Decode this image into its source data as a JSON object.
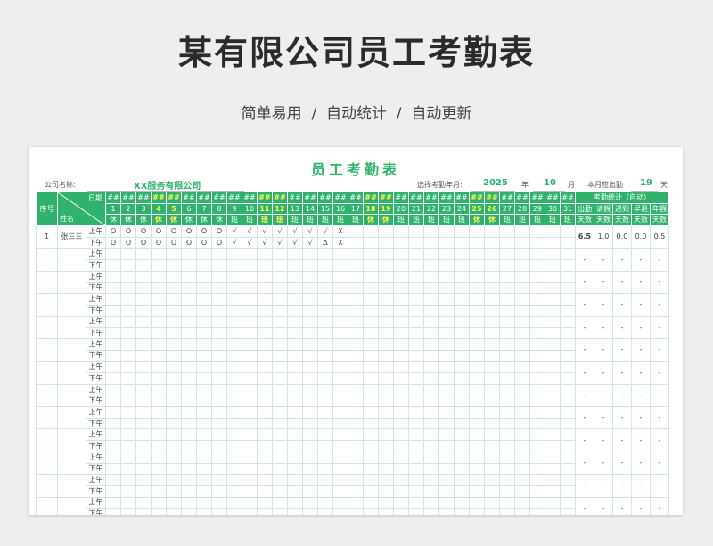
{
  "header": {
    "title": "某有限公司员工考勤表",
    "subtitle": "简单易用  /  自动统计  /  自动更新"
  },
  "sheet": {
    "title": "员工考勤表",
    "company_label": "公司名称:",
    "company_value": "XX服务有限公司",
    "month_label": "选择考勤年月:",
    "year_value": "2025",
    "year_unit": "年",
    "month_value": "10",
    "month_unit": "月",
    "should_label": "本月应出勤",
    "should_value": "19",
    "should_unit": "天",
    "col_seq": "序号",
    "col_name": "姓名",
    "col_date": "日期",
    "weekday_placeholder": "##",
    "days": [
      {
        "n": "1",
        "s": "休",
        "hl": false
      },
      {
        "n": "2",
        "s": "休",
        "hl": false
      },
      {
        "n": "3",
        "s": "休",
        "hl": false
      },
      {
        "n": "4",
        "s": "休",
        "hl": true
      },
      {
        "n": "5",
        "s": "休",
        "hl": true
      },
      {
        "n": "6",
        "s": "休",
        "hl": false
      },
      {
        "n": "7",
        "s": "休",
        "hl": false
      },
      {
        "n": "8",
        "s": "休",
        "hl": false
      },
      {
        "n": "9",
        "s": "班",
        "hl": false
      },
      {
        "n": "10",
        "s": "班",
        "hl": false
      },
      {
        "n": "11",
        "s": "班",
        "hl": true
      },
      {
        "n": "12",
        "s": "班",
        "hl": true
      },
      {
        "n": "13",
        "s": "班",
        "hl": false
      },
      {
        "n": "14",
        "s": "班",
        "hl": false
      },
      {
        "n": "15",
        "s": "班",
        "hl": false
      },
      {
        "n": "16",
        "s": "班",
        "hl": false
      },
      {
        "n": "17",
        "s": "班",
        "hl": false
      },
      {
        "n": "18",
        "s": "休",
        "hl": true
      },
      {
        "n": "19",
        "s": "休",
        "hl": true
      },
      {
        "n": "20",
        "s": "班",
        "hl": false
      },
      {
        "n": "21",
        "s": "班",
        "hl": false
      },
      {
        "n": "22",
        "s": "班",
        "hl": false
      },
      {
        "n": "23",
        "s": "班",
        "hl": false
      },
      {
        "n": "24",
        "s": "班",
        "hl": false
      },
      {
        "n": "25",
        "s": "休",
        "hl": true
      },
      {
        "n": "26",
        "s": "休",
        "hl": true
      },
      {
        "n": "27",
        "s": "班",
        "hl": false
      },
      {
        "n": "28",
        "s": "班",
        "hl": false
      },
      {
        "n": "29",
        "s": "班",
        "hl": false
      },
      {
        "n": "30",
        "s": "班",
        "hl": false
      },
      {
        "n": "31",
        "s": "班",
        "hl": false
      }
    ],
    "stats_title": "考勤统计（自动）",
    "stats_cols": [
      {
        "top": "出勤",
        "bot": "天数"
      },
      {
        "top": "请假",
        "bot": "天数"
      },
      {
        "top": "迟到",
        "bot": "天数"
      },
      {
        "top": "早退",
        "bot": "天数"
      },
      {
        "top": "年假",
        "bot": "天数"
      }
    ],
    "am_label": "上午",
    "pm_label": "下午",
    "dash": "-",
    "employees": [
      {
        "seq": "1",
        "name": "张三三",
        "am": [
          "O",
          "O",
          "O",
          "O",
          "O",
          "O",
          "O",
          "O",
          "√",
          "√",
          "√",
          "√",
          "√",
          "√",
          "√",
          "X"
        ],
        "pm": [
          "O",
          "O",
          "O",
          "O",
          "O",
          "O",
          "O",
          "O",
          "√",
          "√",
          "√",
          "√",
          "√",
          "√",
          "Δ",
          "X"
        ],
        "stats": [
          "6.5",
          "1.0",
          "0.0",
          "0.0",
          "0.5"
        ]
      }
    ],
    "empty_employee_count": 12
  }
}
